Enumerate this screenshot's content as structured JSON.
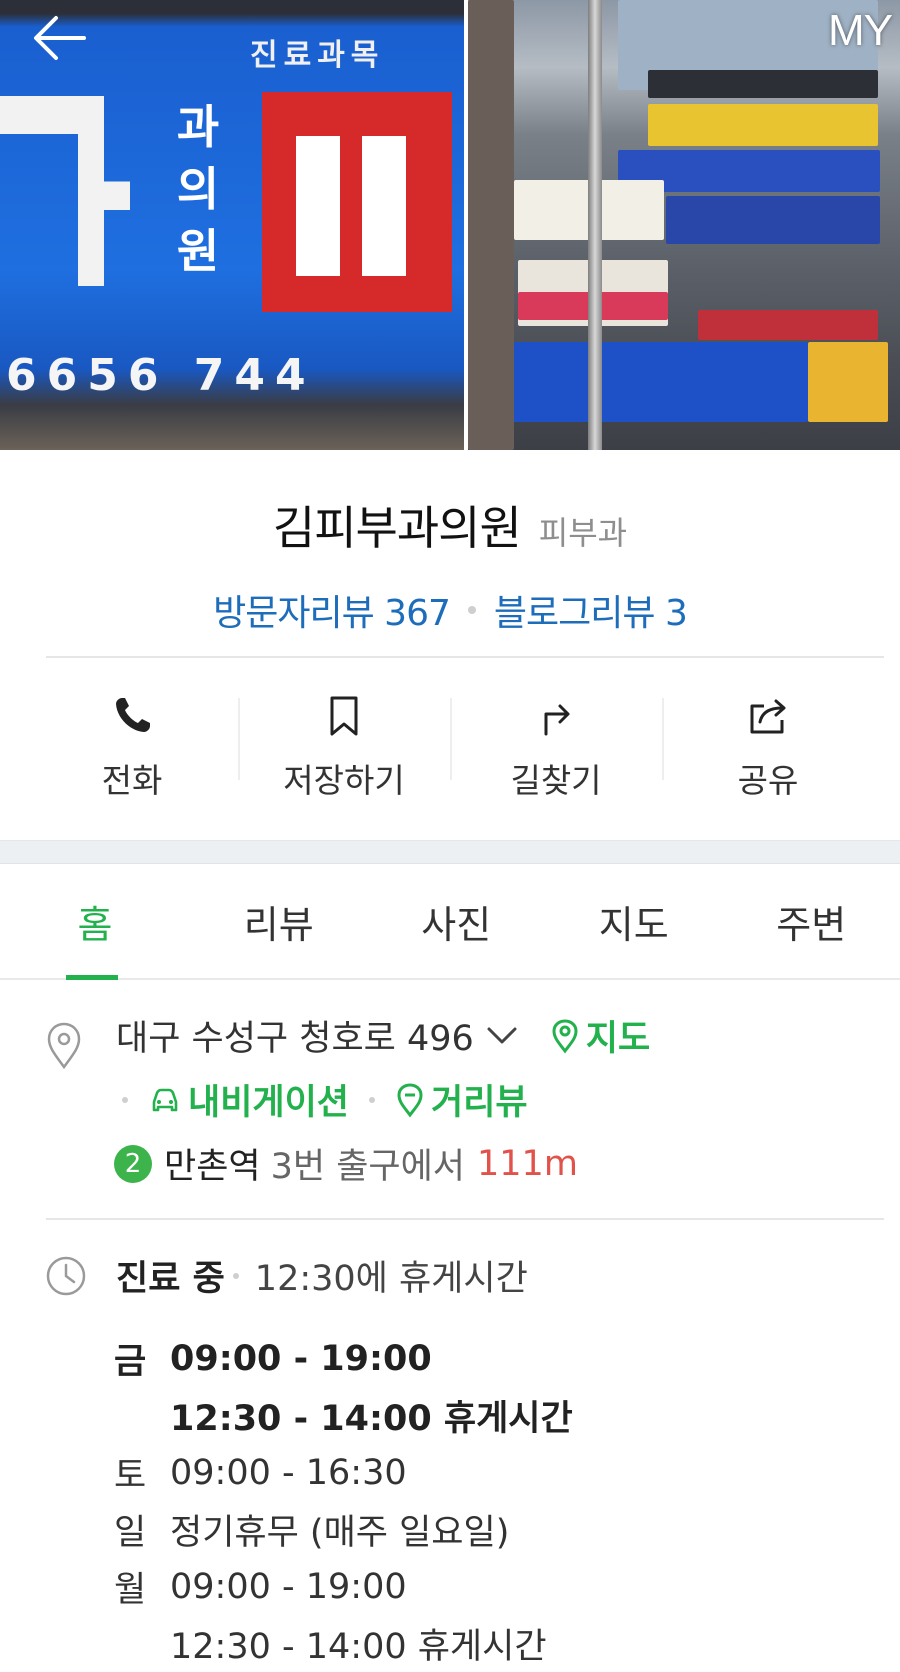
{
  "header": {
    "my_label": "MY"
  },
  "photo_left_texts": {
    "top": "진료과목",
    "vertical": "과 의 원",
    "phone": "6656 744"
  },
  "place": {
    "name": "김피부과의원",
    "category": "피부과"
  },
  "reviews": {
    "visitor": "방문자리뷰 367",
    "blog": "블로그리뷰 3"
  },
  "actions": [
    {
      "label": "전화",
      "icon": "phone-icon"
    },
    {
      "label": "저장하기",
      "icon": "bookmark-icon"
    },
    {
      "label": "길찾기",
      "icon": "directions-icon"
    },
    {
      "label": "공유",
      "icon": "share-icon"
    }
  ],
  "tabs": [
    "홈",
    "리뷰",
    "사진",
    "지도",
    "주변"
  ],
  "address": {
    "text": "대구 수성구 청호로 496",
    "map_link": "지도",
    "navigation_link": "내비게이션",
    "streetview_link": "거리뷰",
    "subway_line": "2",
    "station": "만촌역",
    "exit": "3번 출구에서",
    "distance": "111m"
  },
  "hours": {
    "status": "진료 중",
    "next_break": "12:30에 휴게시간",
    "schedule": [
      {
        "day": "금",
        "time": "09:00 - 19:00",
        "bold": true
      },
      {
        "day": "",
        "time": "12:30 - 14:00 휴게시간",
        "bold": true
      },
      {
        "day": "토",
        "time": "09:00 - 16:30",
        "bold": false
      },
      {
        "day": "일",
        "time": "정기휴무 (매주 일요일)",
        "bold": false
      },
      {
        "day": "월",
        "time": "09:00 - 19:00",
        "bold": false
      },
      {
        "day": "",
        "time": "12:30 - 14:00 휴게시간",
        "bold": false
      }
    ]
  },
  "colors": {
    "accent_green": "#22b14c",
    "link_blue": "#1d6dbb",
    "distance_red": "#e0524a",
    "line2_green": "#3cb44b"
  }
}
